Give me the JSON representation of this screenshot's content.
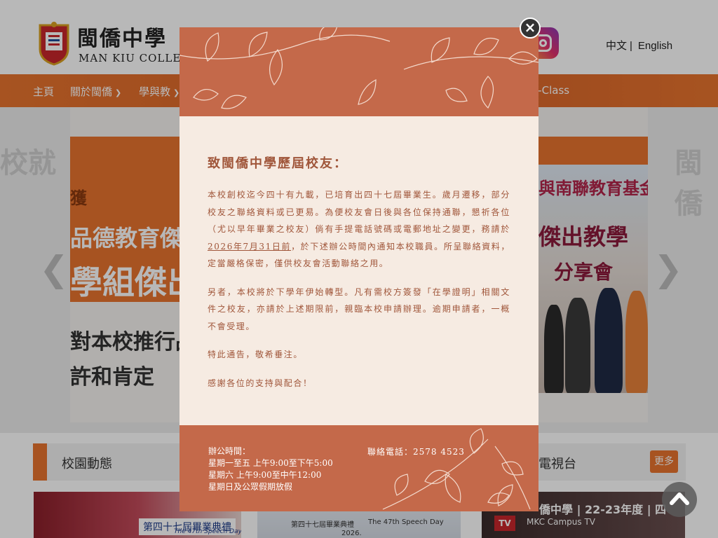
{
  "header": {
    "school_name_zh": "閩僑中學",
    "school_name_en": "MAN KIU COLLEGE",
    "lang_zh": "中文",
    "lang_sep": "|",
    "lang_en": "English"
  },
  "nav": {
    "items": [
      {
        "label": "主頁"
      },
      {
        "label": "關於閩僑"
      },
      {
        "label": "學與教"
      },
      {
        "label": "e-Class"
      }
    ]
  },
  "banner": {
    "ghost_left": "校就",
    "ghost_right": "閩僑",
    "left_text_1": "獲",
    "left_text_2": "品德教育傑出",
    "left_text_3": "學組傑出",
    "left_text_4": "對本校推行品",
    "left_text_5": "許和肯定",
    "right_text_1": "與南聯教育基金",
    "right_text_2": "傑出教學",
    "right_text_3": "分享會"
  },
  "sections": {
    "campus_news": "校園動態",
    "tv": "電視台",
    "more": "更多",
    "thumb1_text": "第四十七屆畢業典禮",
    "thumb1_sub": "The 47th Speech Day",
    "thumb2_text": "第四十七屆畢業典禮",
    "thumb2_sub": "The 47th Speech Day",
    "thumb2_date": "2026.",
    "thumb3_title": "僑中學 | 22-23年度 | 四",
    "thumb3_sub": "MKC Campus TV"
  },
  "modal": {
    "title": "致閩僑中學歷屆校友：",
    "p1_a": "本校創校迄今四十有九載，已培育出四十七屆畢業生。歲月遷移，部分校友之聯絡資料或已更易。為便校友會日後與各位保持通聯，懇祈各位（尤以早年畢業之校友）倘有手提電話號碼或電郵地址之變更，務請於",
    "p1_deadline": "2026年7月31日前",
    "p1_b": "，於下述辦公時間內通知本校職員。所呈聯絡資料，定當嚴格保密，僅供校友會活動聯絡之用。",
    "p2": "另者，本校將於下學年伊始轉型。凡有需校方簽發「在學證明」相關文件之校友，亦請於上述期限前，親臨本校申請辦理。逾期申請者，一概不會受理。",
    "p3": "特此通告，敬希垂注。",
    "p4": "感謝各位的支持與配合！",
    "office_title": "辦公時間：",
    "office_line1": "星期一至五  上午9:00至下午5:00",
    "office_line2": "星期六  上午9:00至中午12:00",
    "office_line3": "星期日及公眾假期放假",
    "phone": "聯絡電話：2578 4523",
    "close_symbol": "×"
  },
  "colors": {
    "accent": "#e8742e",
    "modal_terracotta": "#c4694a",
    "modal_cream": "#f6ebe2",
    "notice_text": "#a0563a"
  },
  "icons": {
    "crest": "school-crest-icon",
    "instagram": "instagram-icon",
    "close": "close-icon",
    "back_to_top": "chevron-up-icon",
    "nav_chevron": "chevron-down-icon"
  }
}
